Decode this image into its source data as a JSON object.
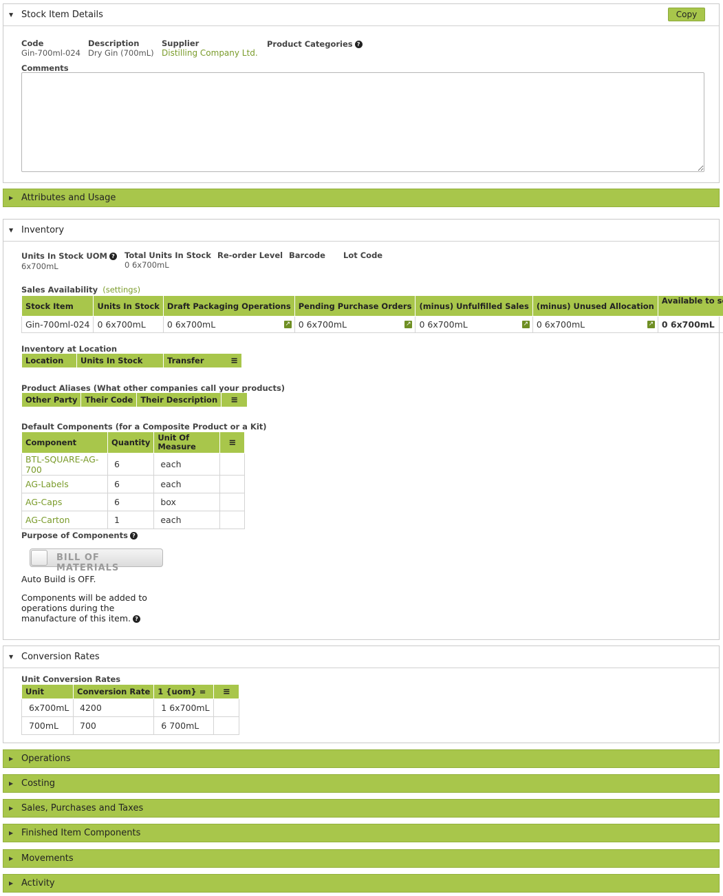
{
  "details": {
    "title": "Stock Item Details",
    "copy_label": "Copy",
    "code_label": "Code",
    "code_value": "Gin-700ml-024",
    "desc_label": "Description",
    "desc_value": "Dry Gin (700mL)",
    "supplier_label": "Supplier",
    "supplier_value": "Distilling Company Ltd.",
    "categories_label": "Product Categories",
    "comments_label": "Comments"
  },
  "sections": {
    "attributes": "Attributes and Usage",
    "inventory": "Inventory",
    "conversion": "Conversion Rates",
    "operations": "Operations",
    "costing": "Costing",
    "sales": "Sales, Purchases and Taxes",
    "finished": "Finished Item Components",
    "movements": "Movements",
    "activity": "Activity"
  },
  "inventory": {
    "uom_label": "Units In Stock UOM",
    "uom_value": "6x700mL",
    "total_label": "Total Units In Stock",
    "total_value": "0 6x700mL",
    "reorder_label": "Re-order Level",
    "barcode_label": "Barcode",
    "lot_label": "Lot Code",
    "sales_avail_label": "Sales Availability",
    "settings_link": "(settings)",
    "sales_headers": [
      "Stock Item",
      "Units In Stock",
      "Draft Packaging Operations",
      "Pending Purchase Orders",
      "(minus) Unfulfilled Sales",
      "(minus) Unused Allocation",
      "Available to sell"
    ],
    "sales_row": [
      "Gin-700ml-024",
      "0 6x700mL",
      "0 6x700mL",
      "0 6x700mL",
      "0 6x700mL",
      "0 6x700mL",
      "0 6x700mL"
    ],
    "location_label": "Inventory at Location",
    "location_headers": [
      "Location",
      "Units In Stock",
      "Transfer"
    ],
    "aliases_label": "Product Aliases (What other companies call your products)",
    "aliases_headers": [
      "Other Party",
      "Their Code",
      "Their Description"
    ],
    "components_label": "Default Components (for a Composite Product or a Kit)",
    "components_headers": [
      "Component",
      "Quantity",
      "Unit Of Measure"
    ],
    "components": [
      {
        "name": "BTL-SQUARE-AG-700",
        "qty": "6",
        "uom": "each"
      },
      {
        "name": "AG-Labels",
        "qty": "6",
        "uom": "each"
      },
      {
        "name": "AG-Caps",
        "qty": "6",
        "uom": "box"
      },
      {
        "name": "AG-Carton",
        "qty": "1",
        "uom": "each"
      }
    ],
    "purpose_label": "Purpose of Components",
    "toggle_label": "BILL OF MATERIALS",
    "autobuild_text": "Auto Build is OFF.",
    "components_note": "Components will be added to operations during the manufacture of this item."
  },
  "conversion": {
    "label": "Unit Conversion Rates",
    "headers": [
      "Unit",
      "Conversion Rate",
      "1 {uom} ="
    ],
    "rows": [
      {
        "unit": "6x700mL",
        "rate": "4200",
        "eq": "1 6x700mL"
      },
      {
        "unit": "700mL",
        "rate": "700",
        "eq": "6 700mL"
      }
    ]
  }
}
